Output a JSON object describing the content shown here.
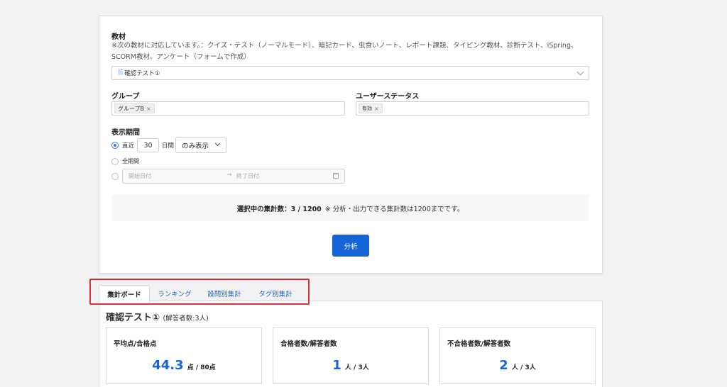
{
  "filters": {
    "material_label": "教材",
    "material_note": "※次の教材に対応しています。：クイズ・テスト（ノーマルモード）、暗記カード、虫食いノート、レポート課題、タイピング教材、診断テスト、iSpring、SCORM教材、アンケート（フォームで作成）",
    "material_value": "確認テスト①",
    "group_label": "グループ",
    "group_tag": "グループB",
    "user_status_label": "ユーザーステータス",
    "user_status_tag": "有効",
    "period_label": "表示期間",
    "recent_label": "直近",
    "recent_value": "30",
    "days_label": "日間",
    "display_select": "のみ表示",
    "all_period_label": "全期間",
    "start_date_placeholder": "開始日付",
    "arrow": "→",
    "end_date_placeholder": "終了日付"
  },
  "summary": {
    "count_text": "選択中の集計数：3 / 1200",
    "note": "※ 分析・出力できる集計数は1200までです。"
  },
  "analyze_button": "分析",
  "tabs": [
    "集計ボード",
    "ランキング",
    "設問別集計",
    "タグ別集計"
  ],
  "report": {
    "title": "確認テスト①",
    "subtitle": "(解答者数:3人)",
    "cards": [
      {
        "title": "平均点/合格点",
        "value": "44.3",
        "unit": "点 / 80点"
      },
      {
        "title": "合格者数/解答者数",
        "value": "1",
        "unit": "人 / 3人"
      },
      {
        "title": "不合格者数/解答者数",
        "value": "2",
        "unit": "人 / 3人"
      }
    ]
  },
  "colors": {
    "accent": "#1565d8",
    "highlight": "#e0303a"
  }
}
